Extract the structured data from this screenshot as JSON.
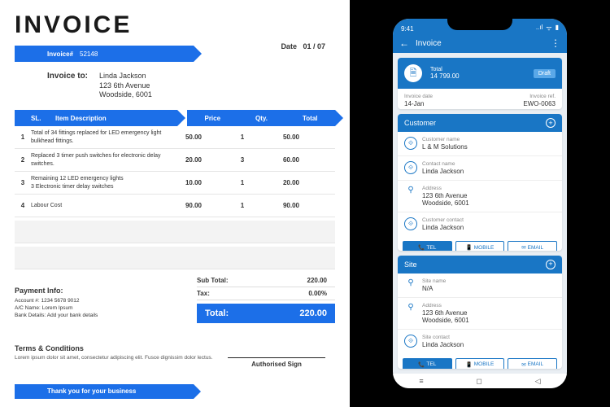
{
  "invoice": {
    "title": "INVOICE",
    "header": {
      "number_label": "Invoice#",
      "number": "52148",
      "date_label": "Date",
      "date": "01 / 07"
    },
    "to": {
      "label": "Invoice to:",
      "name": "Linda Jackson",
      "line1": "123 6th Avenue",
      "line2": "Woodside, 6001"
    },
    "columns": {
      "sl": "SL.",
      "desc": "Item Description",
      "price": "Price",
      "qty": "Qty.",
      "total": "Total"
    },
    "items": [
      {
        "sl": "1",
        "desc": "Total of 34 fittings replaced for LED emergency light bulkhead fittings.",
        "price": "50.00",
        "qty": "1",
        "total": "50.00"
      },
      {
        "sl": "2",
        "desc": "Replaced 3 timer push switches for electronic delay switches.",
        "price": "20.00",
        "qty": "3",
        "total": "60.00"
      },
      {
        "sl": "3",
        "desc": "Remaining 12 LED emergency lights\n3 Electronic timer delay switches",
        "price": "10.00",
        "qty": "1",
        "total": "20.00"
      },
      {
        "sl": "4",
        "desc": "Labour Cost",
        "price": "90.00",
        "qty": "1",
        "total": "90.00"
      }
    ],
    "totals": {
      "subtotal_label": "Sub Total:",
      "subtotal": "220.00",
      "tax_label": "Tax:",
      "tax": "0.00%",
      "total_label": "Total:",
      "total": "220.00"
    },
    "payment": {
      "heading": "Payment Info:",
      "account_lbl": "Account #:",
      "account": "1234 5678 9012",
      "acname_lbl": "A/C Name:",
      "acname": "Lorem Ipsum",
      "bank_lbl": "Bank Details:",
      "bank": "Add your bank details"
    },
    "terms": {
      "heading": "Terms & Conditions",
      "body": "Lorem ipsum dolor sit amet, consectetur adipiscing elit. Fusce dignissim dolor lectus."
    },
    "sign_label": "Authorised Sign",
    "thanks": "Thank you for your business"
  },
  "phone": {
    "clock": "9:41",
    "signal": "..ıl",
    "wifi": "⋮⋮",
    "screen_title": "Invoice",
    "total_card": {
      "label": "Total",
      "amount": "14 799.00",
      "badge": "Draft"
    },
    "meta": {
      "date_lbl": "Invoice date",
      "date": "14-Jan",
      "ref_lbl": "Invoice ref.",
      "ref": "EWO-0063"
    },
    "customer": {
      "heading": "Customer",
      "name_lbl": "Customer name",
      "name": "L & M Solutions",
      "contact_lbl": "Contact name",
      "contact": "Linda Jackson",
      "addr_lbl": "Address",
      "addr": "123 6th Avenue\nWoodside, 6001",
      "cust_contact_lbl": "Customer contact",
      "cust_contact": "Linda Jackson"
    },
    "site": {
      "heading": "Site",
      "name_lbl": "Site name",
      "name": "N/A",
      "addr_lbl": "Address",
      "addr": "123 6th Avenue\nWoodside, 6001",
      "contact_lbl": "Site contact",
      "contact": "Linda Jackson"
    },
    "buttons": {
      "tel": "TEL",
      "mobile": "MOBILE",
      "email": "EMAIL"
    }
  }
}
